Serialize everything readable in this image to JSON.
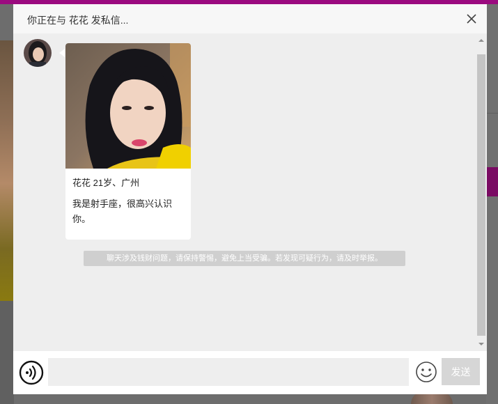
{
  "dialog": {
    "title": "你正在与 花花 发私信..."
  },
  "profile_card": {
    "meta": "花花 21岁、广州",
    "message": "我是射手座，很高兴认识你。"
  },
  "notice": {
    "text": "聊天涉及钱财问题，请保持警惕，避免上当受骗。若发现可疑行为，请及时举报。"
  },
  "composer": {
    "input_value": "",
    "input_placeholder": "",
    "send_label": "发送"
  },
  "icons": {
    "close": "close-icon",
    "voice": "voice-icon",
    "emoji": "emoji-icon"
  },
  "colors": {
    "brand": "#9b0a7f",
    "send_disabled": "#d6d6d6",
    "notice_bg": "#cfcfcf"
  }
}
